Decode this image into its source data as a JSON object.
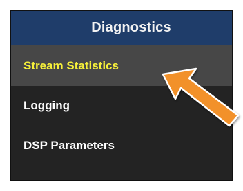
{
  "panel": {
    "title": "Diagnostics"
  },
  "menu": {
    "items": [
      {
        "label": "Stream Statistics",
        "active": true
      },
      {
        "label": "Logging",
        "active": false
      },
      {
        "label": "DSP Parameters",
        "active": false
      }
    ]
  },
  "colors": {
    "header_bg": "#1f3d6a",
    "menu_bg": "#232323",
    "active_bg": "#474747",
    "active_text": "#f6f03a",
    "arrow": "#f2912b"
  },
  "annotation": {
    "icon": "arrow-pointer-icon"
  }
}
